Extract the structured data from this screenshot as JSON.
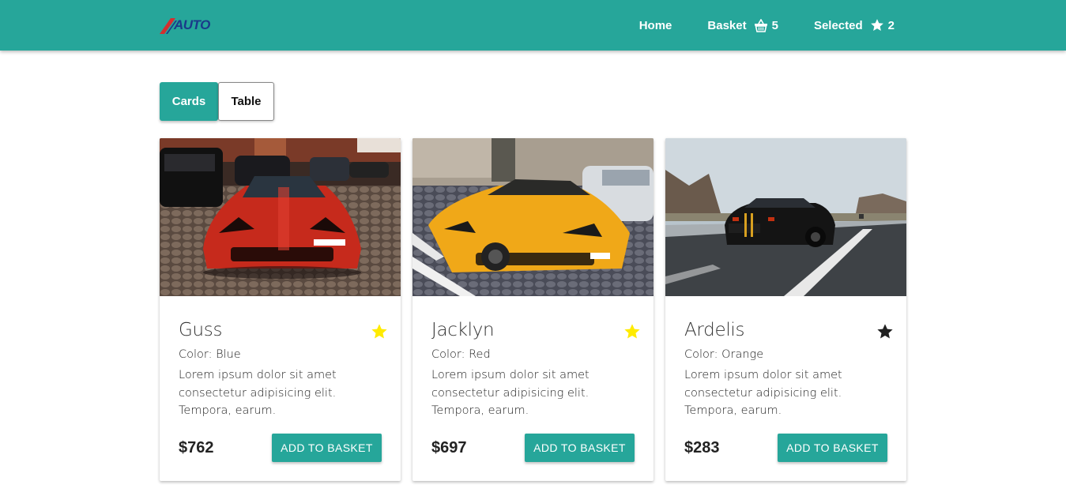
{
  "brand": {
    "logo_text": "AUTO",
    "accent_color": "#26a69a",
    "logo_stripe_color": "#d32f2f",
    "logo_text_color": "#1a3a8a"
  },
  "nav": {
    "home_label": "Home",
    "basket_label": "Basket",
    "basket_icon": "basket-icon",
    "basket_count": "5",
    "selected_label": "Selected",
    "selected_icon": "star-icon",
    "selected_count": "2"
  },
  "view_toggle": {
    "cards_label": "Cards",
    "table_label": "Table",
    "active": "Cards"
  },
  "cards": [
    {
      "name": "Guss",
      "color": "Color: Blue",
      "description": "Lorem ipsum dolor sit amet consectetur adipisicing elit. Tempora, earum.",
      "price": "$762",
      "button": "ADD TO BASKET",
      "selected": true,
      "star_color": "#ffeb00",
      "image": "red sports car in parking garage"
    },
    {
      "name": "Jacklyn",
      "color": "Color: Red",
      "description": "Lorem ipsum dolor sit amet consectetur adipisicing elit. Tempora, earum.",
      "price": "$697",
      "button": "ADD TO BASKET",
      "selected": true,
      "star_color": "#ffeb00",
      "image": "yellow sports car on cobblestone street"
    },
    {
      "name": "Ardelis",
      "color": "Color: Orange",
      "description": "Lorem ipsum dolor sit amet consectetur adipisicing elit. Tempora, earum.",
      "price": "$283",
      "button": "ADD TO BASKET",
      "selected": false,
      "star_color": "#212121",
      "image": "black muscle car on highway"
    }
  ]
}
